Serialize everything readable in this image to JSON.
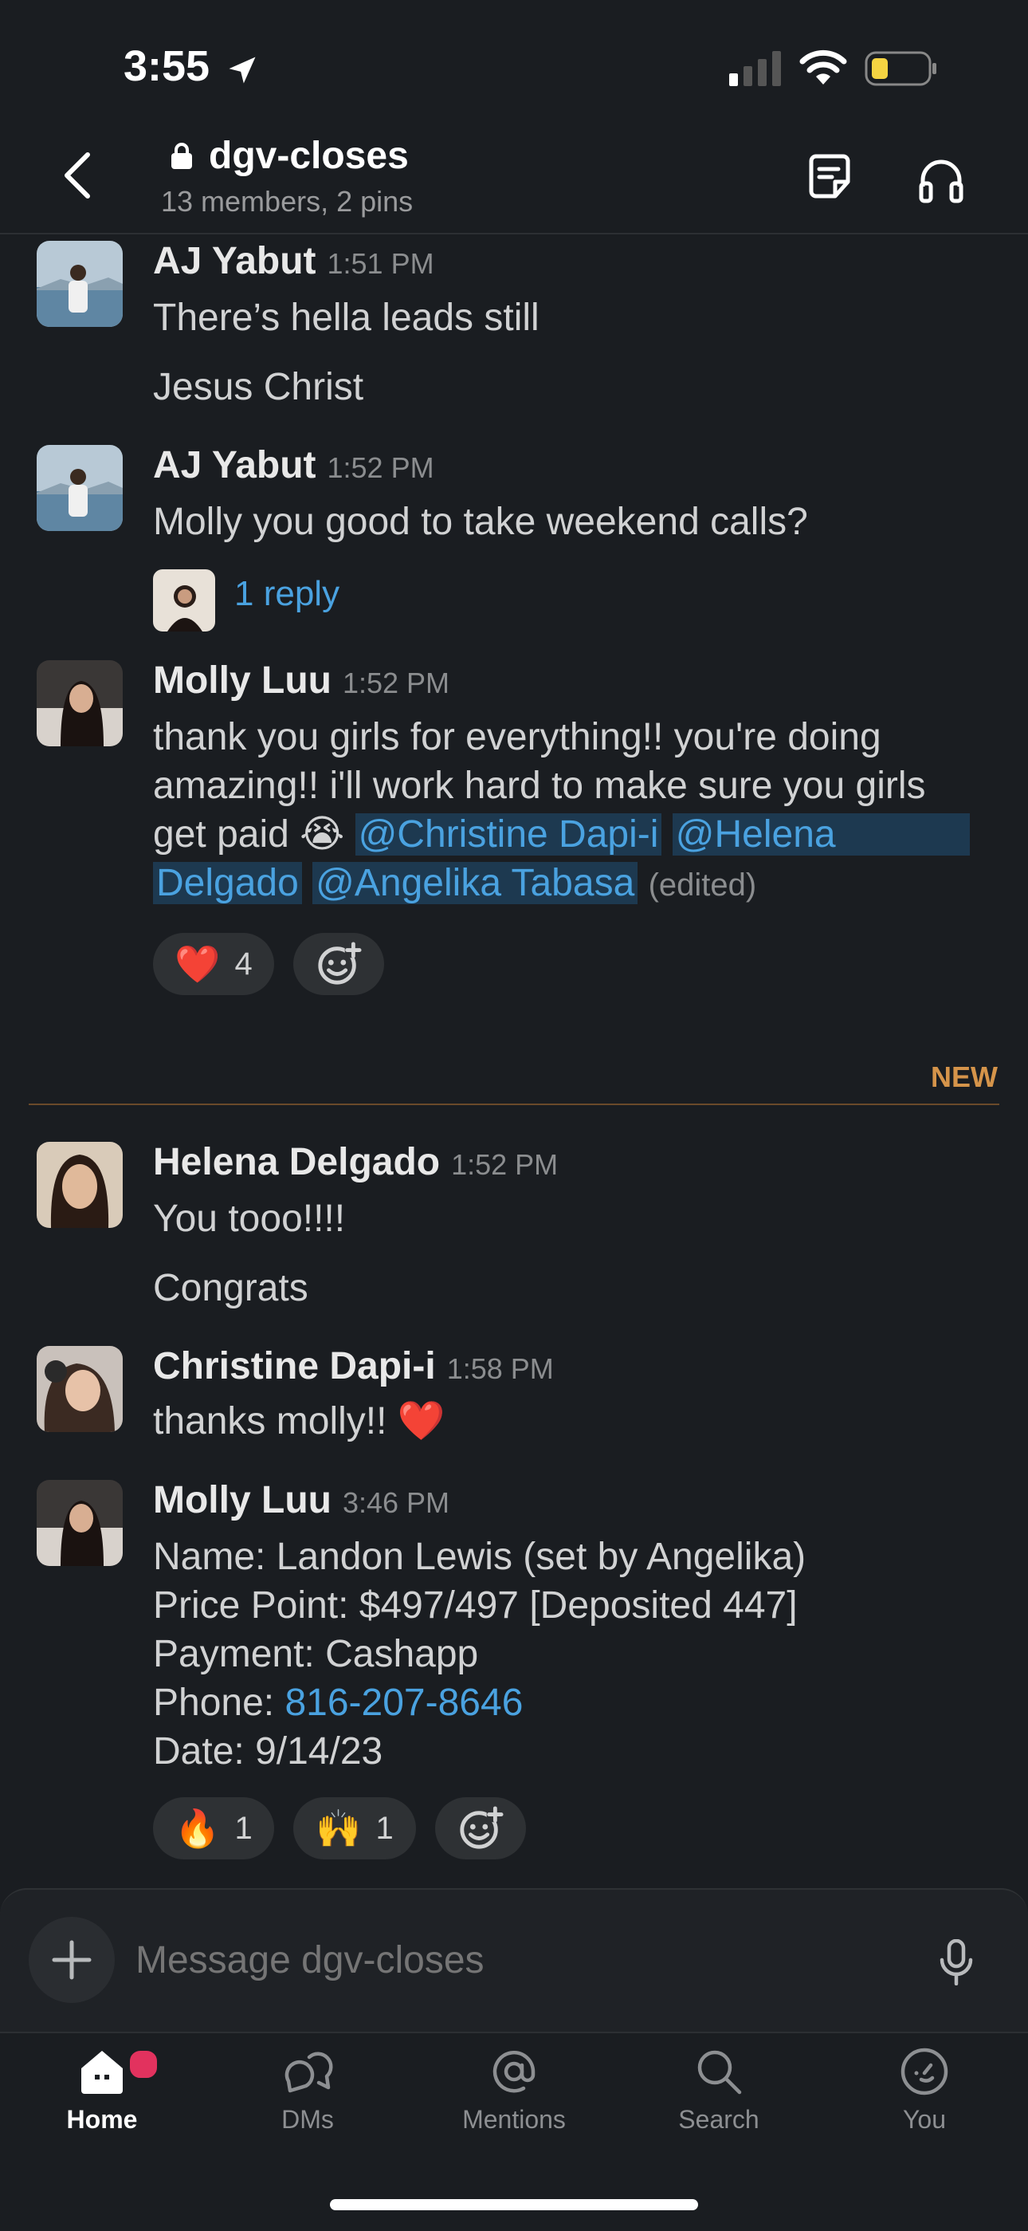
{
  "status_bar": {
    "time": "3:55"
  },
  "header": {
    "channel_name": "dgv-closes",
    "subtitle": "13 members, 2 pins"
  },
  "messages": [
    {
      "author": "AJ Yabut",
      "time": "1:51 PM",
      "lines": [
        "There’s hella leads still",
        "Jesus Christ"
      ]
    },
    {
      "author": "AJ Yabut",
      "time": "1:52 PM",
      "lines": [
        "Molly you good to take weekend calls?"
      ],
      "thread": "1 reply"
    },
    {
      "author": "Molly Luu",
      "time": "1:52 PM",
      "text_line1": "thank you girls for everything!! you're doing",
      "text_line2": "amazing!! i'll work hard to make sure you girls",
      "text_line3_prefix": "get paid 😭 ",
      "mentions": [
        "@Christine Dapi-i",
        "@Helena",
        "Delgado",
        "@Angelika Tabasa"
      ],
      "edited": "(edited)",
      "reactions": [
        {
          "emoji": "❤️",
          "count": "4"
        }
      ]
    },
    {
      "author": "Helena Delgado",
      "time": "1:52 PM",
      "lines": [
        "You tooo!!!!",
        "Congrats"
      ]
    },
    {
      "author": "Christine Dapi-i",
      "time": "1:58 PM",
      "lines": [
        "thanks molly!! ❤️"
      ]
    },
    {
      "author": "Molly Luu",
      "time": "3:46 PM",
      "lines": [
        "Name: Landon Lewis (set by Angelika)",
        "Price Point: $497/497 [Deposited 447]",
        "Payment: Cashapp"
      ],
      "phone_label": "Phone: ",
      "phone": "816-207-8646",
      "date_line": "Date: 9/14/23",
      "reactions": [
        {
          "emoji": "🔥",
          "count": "1"
        },
        {
          "emoji": "🙌",
          "count": "1"
        }
      ]
    }
  ],
  "new_divider": "NEW",
  "composer": {
    "placeholder": "Message dgv-closes"
  },
  "tabs": [
    {
      "label": "Home",
      "icon": "home-icon"
    },
    {
      "label": "DMs",
      "icon": "dms-icon"
    },
    {
      "label": "Mentions",
      "icon": "mentions-icon"
    },
    {
      "label": "Search",
      "icon": "search-icon"
    },
    {
      "label": "You",
      "icon": "you-icon"
    }
  ],
  "colors": {
    "background": "#1a1d21",
    "link": "#4aa2e0",
    "new_divider": "#d5944a",
    "notification_dot": "#e2325e"
  }
}
